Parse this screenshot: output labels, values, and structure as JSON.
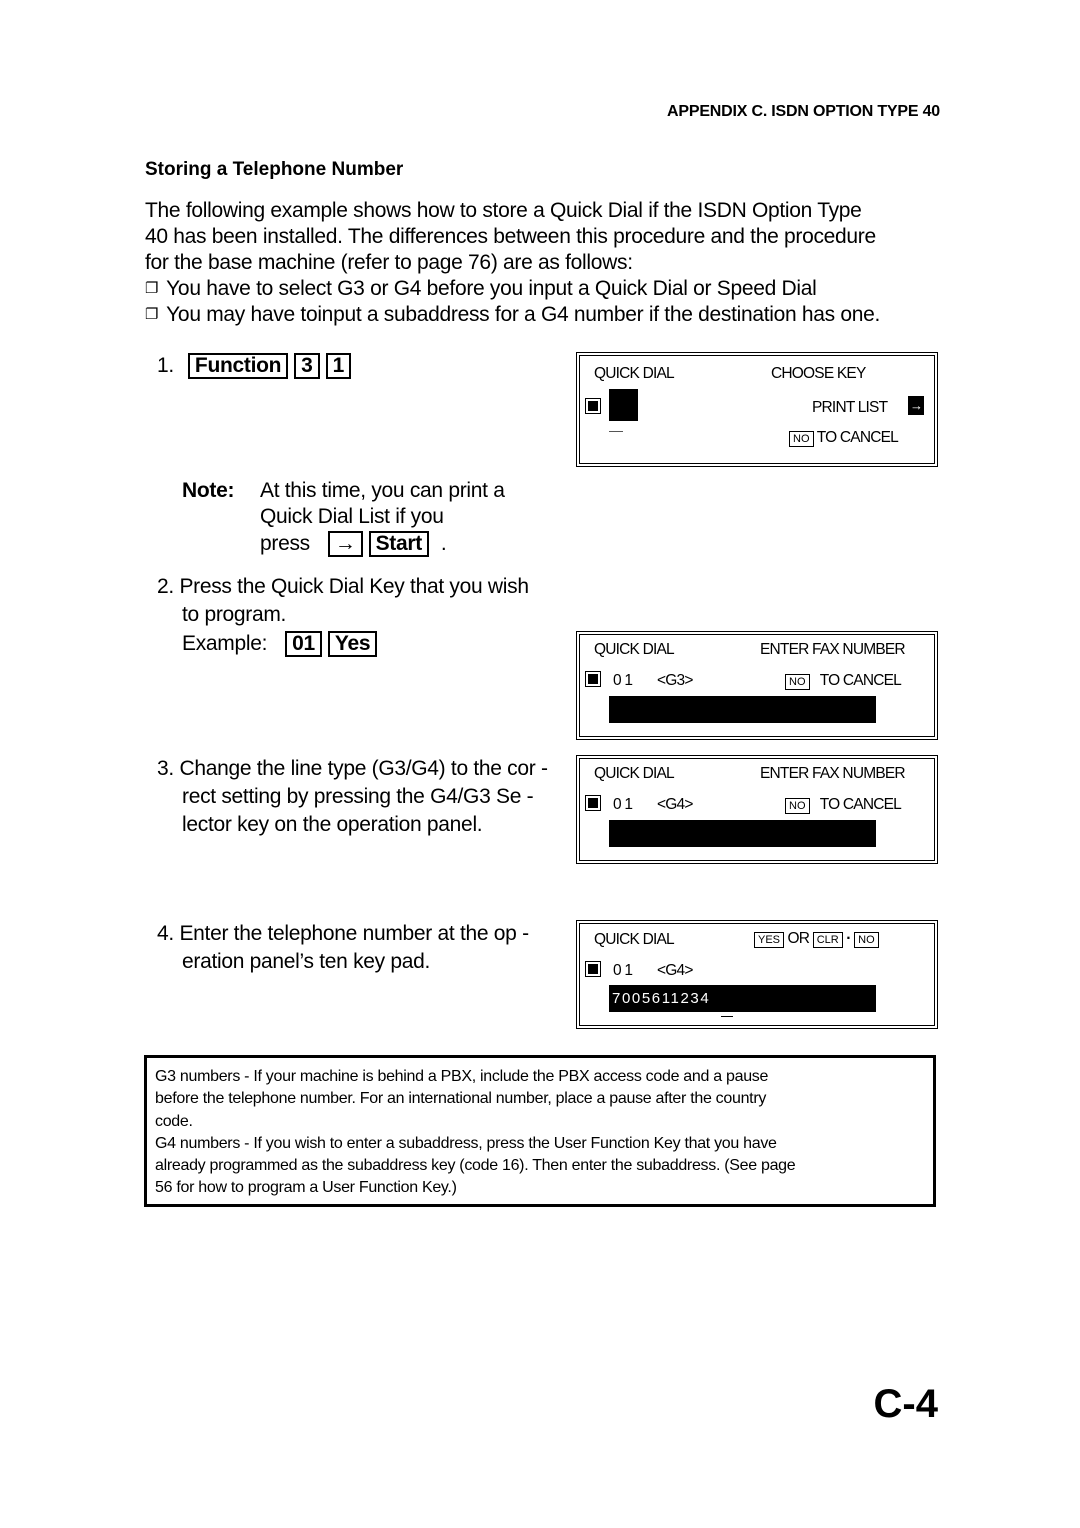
{
  "header": {
    "running_title": "APPENDIX C. ISDN OPTION TYPE 40"
  },
  "section": {
    "title": "Storing a Telephone Number",
    "intro_lines": [
      "The following example shows how to store a Quick Dial if the ISDN Option Type",
      "40 has been installed. The differences between this procedure and the procedure",
      "for the base machine (refer to page  76) are as follows:"
    ],
    "bullets": [
      "You have to select G3 or G4 before you input a Quick Dial or Speed Dial",
      "You may have toinput a subaddress for a G4 number if the destination has one."
    ],
    "bullet_glyph": "❐"
  },
  "steps": {
    "step1": {
      "number": "1.",
      "keys": [
        "Function",
        "3",
        "1"
      ]
    },
    "note": {
      "label": "Note:",
      "line1": "At this time, you can print a",
      "line2": "Quick Dial List if you",
      "line3": "press",
      "keys": [
        "→",
        "Start"
      ],
      "end": "."
    },
    "step2": {
      "line1": "2. Press the Quick Dial Key that you wish",
      "line2": "to program.",
      "example_label": "Example:",
      "keys": [
        "01",
        "Yes"
      ]
    },
    "step3": {
      "line1": "3. Change the line type (G3/G4) to the cor -",
      "line2": "rect setting by pressing the G4/G3 Se -",
      "line3": "lector key on the operation panel."
    },
    "step4": {
      "line1": "4. Enter the telephone number at the op -",
      "line2": "eration panel’s ten key pad."
    }
  },
  "displays": {
    "d1": {
      "left": "QUICK DIAL",
      "right": "CHOOSE KEY",
      "print_list": "PRINT LIST",
      "arrow": "→",
      "no": "NO",
      "cancel": "TO CANCEL"
    },
    "d2": {
      "left": "QUICK DIAL",
      "right": "ENTER FAX NUMBER",
      "slot": "0 1",
      "line": "<G3>",
      "no": "NO",
      "cancel": "TO CANCEL"
    },
    "d3": {
      "left": "QUICK DIAL",
      "right": "ENTER FAX NUMBER",
      "slot": "0 1",
      "line": "<G4>",
      "no": "NO",
      "cancel": "TO CANCEL"
    },
    "d4": {
      "left": "QUICK DIAL",
      "yes": "YES",
      "or": "OR",
      "clr": "CLR",
      "dot": "·",
      "no": "NO",
      "slot": "0 1",
      "line": "<G4>",
      "number": "7005611234"
    }
  },
  "notebox": {
    "lines": [
      "G3 numbers - If your machine is behind a PBX, include the PBX access code and a pause",
      "before the telephone number. For an international number, place a pause after the country",
      "code.",
      "G4 numbers - If you wish to enter a subaddress, press the User Function Key that you have",
      "already programmed as the subaddress key (code 16). Then enter the subaddress. (See page",
      "56 for how to program a User Function Key.)"
    ]
  },
  "page_number": "C-4"
}
